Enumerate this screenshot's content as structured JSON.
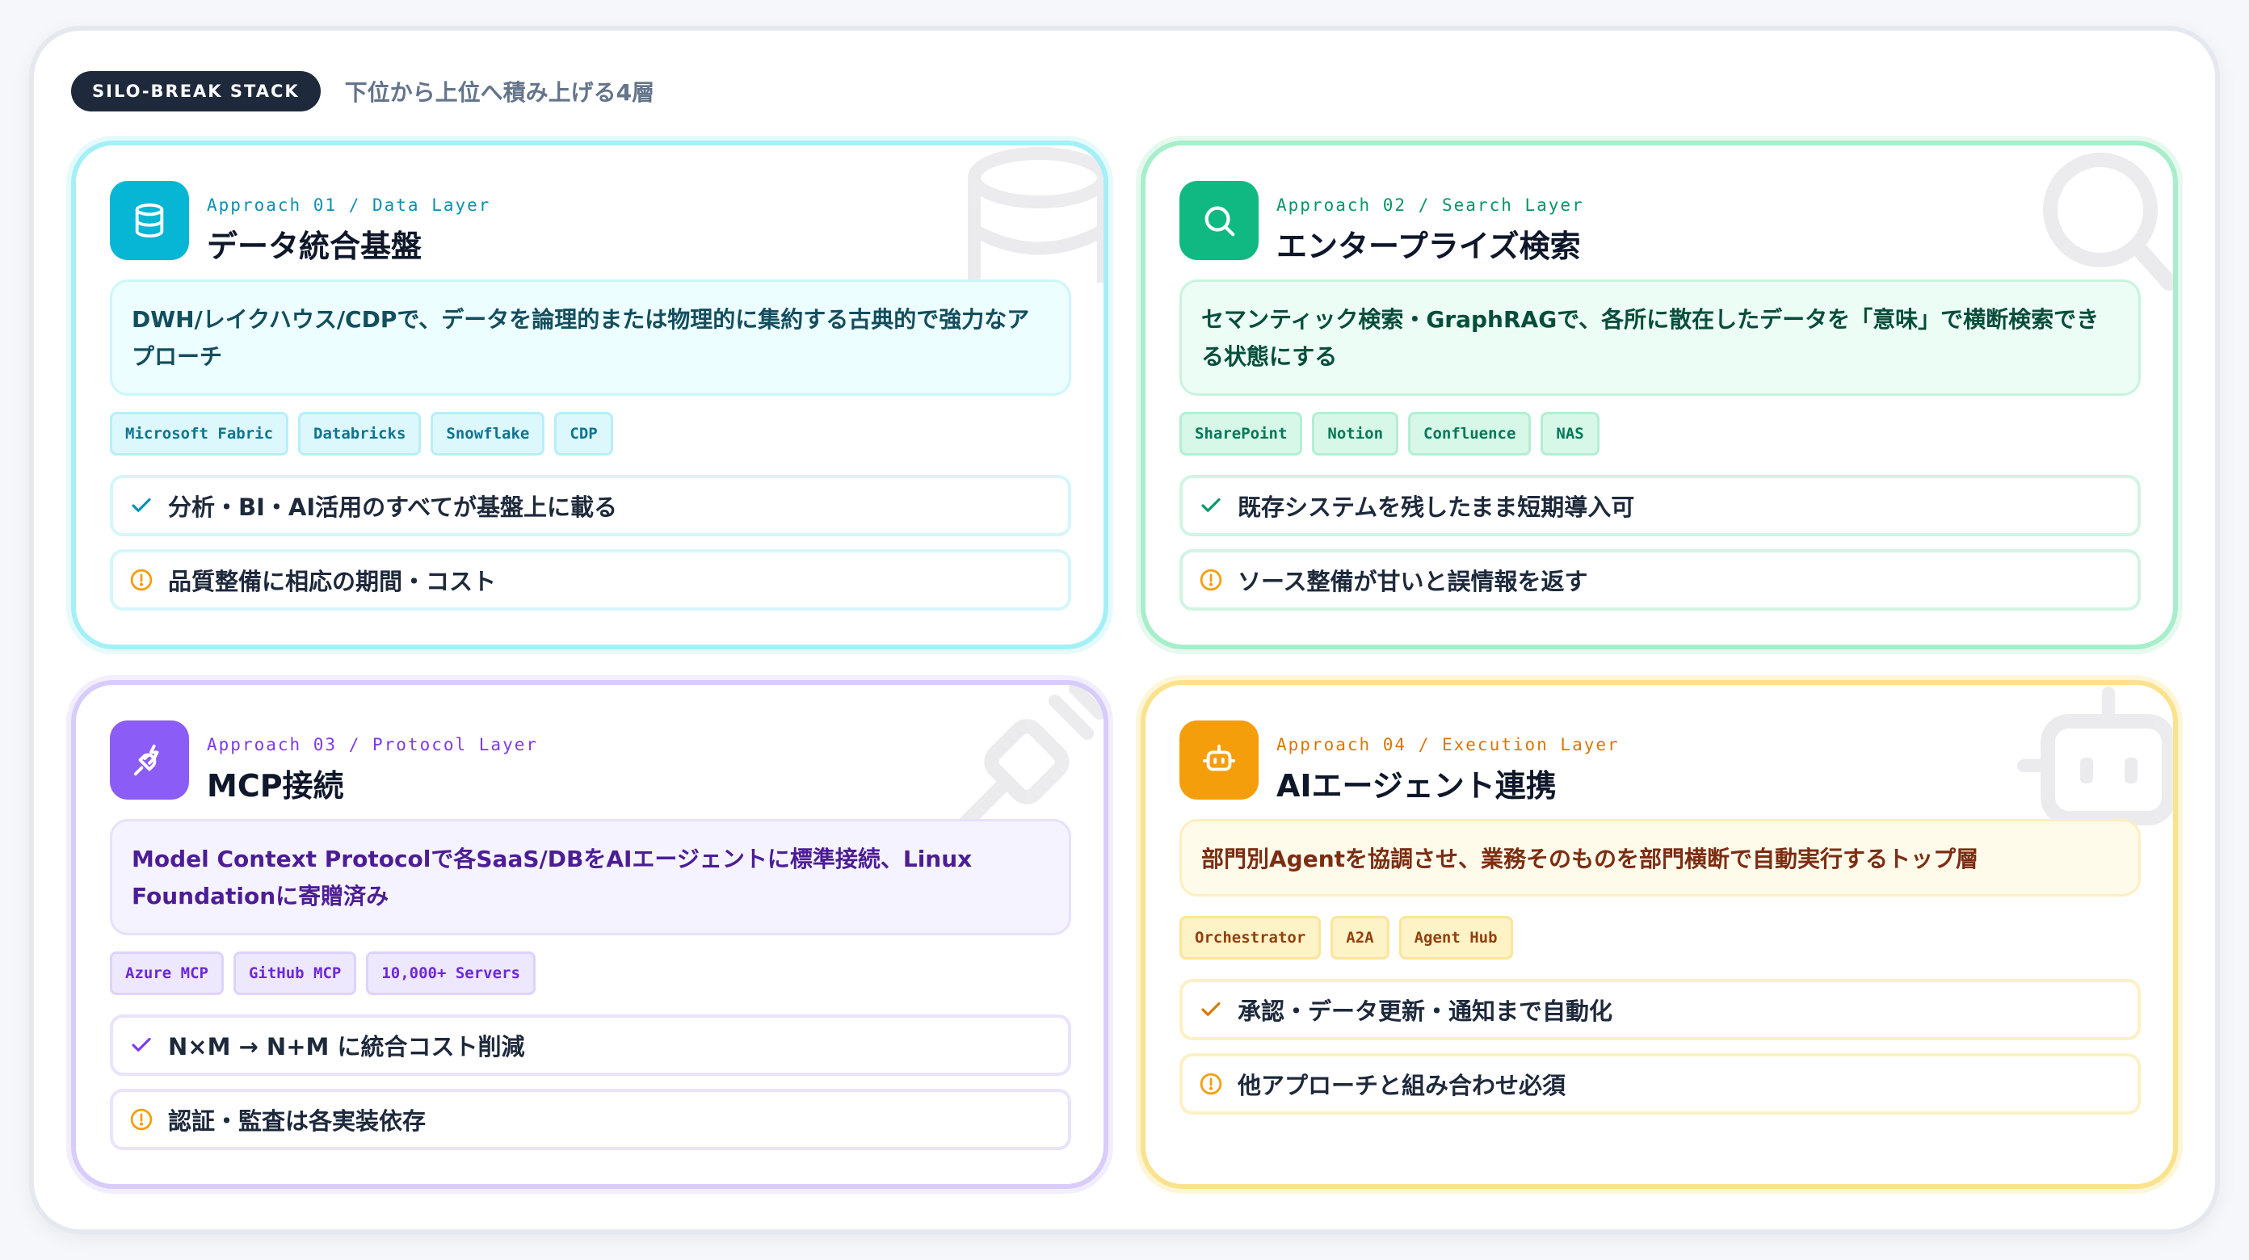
{
  "header": {
    "badge": "SILO-BREAK STACK",
    "subtitle": "下位から上位へ積み上げる4層"
  },
  "cards": [
    {
      "eyebrow": "Approach 01 / Data Layer",
      "title": "データ統合基盤",
      "icon": "database-icon",
      "description": "DWH/レイクハウス/CDPで、データを論理的または物理的に集約する古典的で強力なアプローチ",
      "tags": [
        "Microsoft Fabric",
        "Databricks",
        "Snowflake",
        "CDP"
      ],
      "pro": "分析・BI・AI活用のすべてが基盤上に載る",
      "con": "品質整備に相応の期間・コスト"
    },
    {
      "eyebrow": "Approach 02 / Search Layer",
      "title": "エンタープライズ検索",
      "icon": "search-icon",
      "description": "セマンティック検索・GraphRAGで、各所に散在したデータを「意味」で横断検索できる状態にする",
      "tags": [
        "SharePoint",
        "Notion",
        "Confluence",
        "NAS"
      ],
      "pro": "既存システムを残したまま短期導入可",
      "con": "ソース整備が甘いと誤情報を返す"
    },
    {
      "eyebrow": "Approach 03 / Protocol Layer",
      "title": "MCP接続",
      "icon": "plug-icon",
      "description": "Model Context Protocolで各SaaS/DBをAIエージェントに標準接続、Linux Foundationに寄贈済み",
      "tags": [
        "Azure MCP",
        "GitHub MCP",
        "10,000+ Servers"
      ],
      "pro": "N×M → N+M に統合コスト削減",
      "con": "認証・監査は各実装依存"
    },
    {
      "eyebrow": "Approach 04 / Execution Layer",
      "title": "AIエージェント連携",
      "icon": "robot-icon",
      "description": "部門別Agentを協調させ、業務そのものを部門横断で自動実行するトップ層",
      "tags": [
        "Orchestrator",
        "A2A",
        "Agent Hub"
      ],
      "pro": "承認・データ更新・通知まで自動化",
      "con": "他アプローチと組み合わせ必須"
    }
  ],
  "colors": {
    "cyan": "#06b6d4",
    "green": "#10b981",
    "purple": "#8b5cf6",
    "amber": "#f59e0b",
    "pro_check": [
      "#0891b2",
      "#059669",
      "#7c3aed",
      "#d97706"
    ],
    "con_warning": "#f59e0b"
  }
}
